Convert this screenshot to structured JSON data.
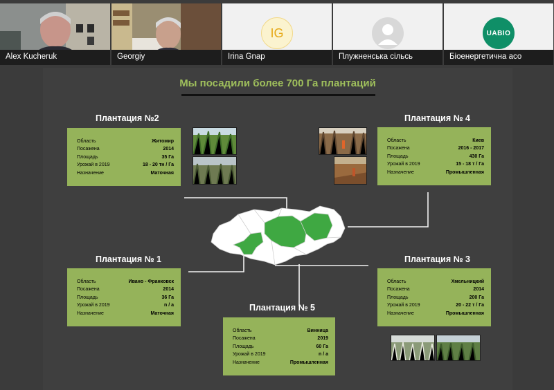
{
  "participants": [
    {
      "name": "Alex Kucheruk"
    },
    {
      "name": "Georgiy"
    },
    {
      "name": "Irina Gnap",
      "initials": "IG"
    },
    {
      "name": "Плужненська сільсь"
    },
    {
      "name": "Біоенергетична асо",
      "logo_text": "UABIO"
    }
  ],
  "slide": {
    "title": "Мы посадили более 700 Га плантаций",
    "plantations": [
      {
        "title": "Плантация №2",
        "rows": [
          {
            "label": "Область",
            "value": "Житомир"
          },
          {
            "label": "Посажена",
            "value": "2014"
          },
          {
            "label": "Площадь",
            "value": "35 Га"
          },
          {
            "label": "Урожай в 2019",
            "value": "18 - 20 тн / Га"
          },
          {
            "label": "Назначение",
            "value": "Маточная"
          }
        ]
      },
      {
        "title": "Плантация № 4",
        "rows": [
          {
            "label": "Область",
            "value": "Киев"
          },
          {
            "label": "Посажена",
            "value": "2016 - 2017"
          },
          {
            "label": "Площадь",
            "value": "430 Га"
          },
          {
            "label": "Урожай в 2019",
            "value": "15 - 18 т / Га"
          },
          {
            "label": "Назначение",
            "value": "Промышленная"
          }
        ]
      },
      {
        "title": "Плантация № 1",
        "rows": [
          {
            "label": "Область",
            "value": "Ивано - Франковск"
          },
          {
            "label": "Посажена",
            "value": "2014"
          },
          {
            "label": "Площадь",
            "value": "36 Га"
          },
          {
            "label": "Урожай в 2019",
            "value": "n / a"
          },
          {
            "label": "Назначение",
            "value": "Маточная"
          }
        ]
      },
      {
        "title": "Плантация № 3",
        "rows": [
          {
            "label": "Область",
            "value": "Хмельницкий"
          },
          {
            "label": "Посажена",
            "value": "2014"
          },
          {
            "label": "Площадь",
            "value": "200 Га"
          },
          {
            "label": "Урожай в 2019",
            "value": "20 - 22 т / Га"
          },
          {
            "label": "Назначение",
            "value": "Промышленная"
          }
        ]
      },
      {
        "title": "Плантация № 5",
        "rows": [
          {
            "label": "Область",
            "value": "Винница"
          },
          {
            "label": "Посажена",
            "value": "2019"
          },
          {
            "label": "Площадь",
            "value": "60 Га"
          },
          {
            "label": "Урожай в 2019",
            "value": "n / a"
          },
          {
            "label": "Назначение",
            "value": "Промышленная"
          }
        ]
      }
    ]
  },
  "colors": {
    "title_green": "#9fbf5c",
    "card_green": "#95b35a",
    "map_green": "#3fa842",
    "uabio_green": "#0f8f67"
  }
}
